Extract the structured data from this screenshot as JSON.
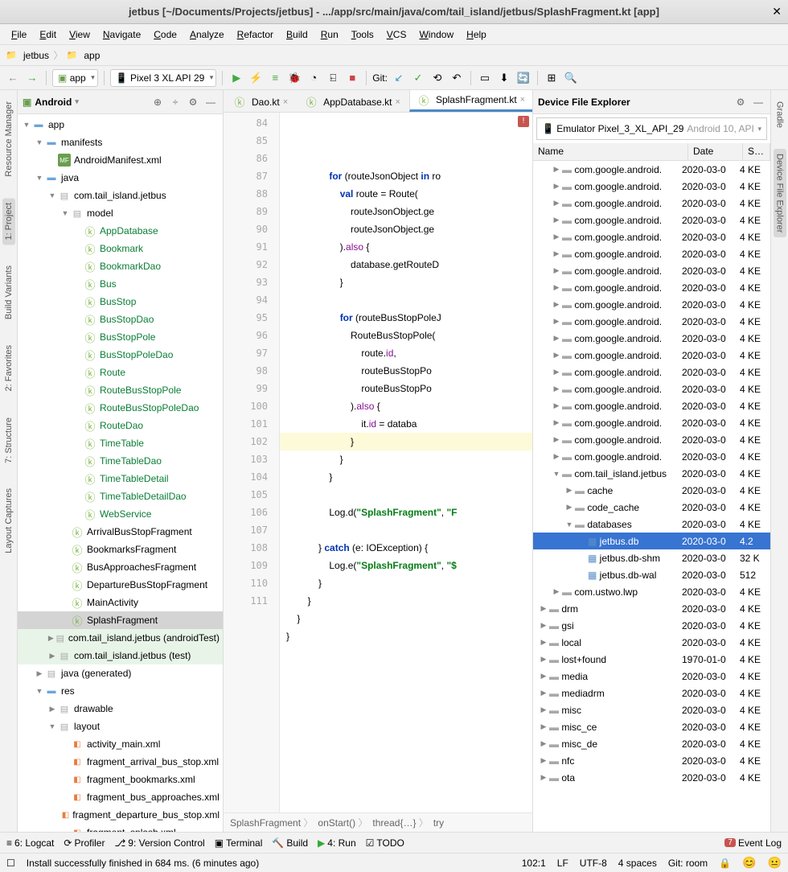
{
  "title": "jetbus [~/Documents/Projects/jetbus] - .../app/src/main/java/com/tail_island/jetbus/SplashFragment.kt [app]",
  "menu": [
    "File",
    "Edit",
    "View",
    "Navigate",
    "Code",
    "Analyze",
    "Refactor",
    "Build",
    "Run",
    "Tools",
    "VCS",
    "Window",
    "Help"
  ],
  "nav": {
    "p1": "jetbus",
    "p2": "app"
  },
  "toolbar": {
    "module": "app",
    "device": "Pixel 3 XL API 29",
    "git": "Git:"
  },
  "left_tabs": [
    "Resource Manager",
    "1: Project",
    "Build Variants",
    "2: Favorites",
    "7: Structure",
    "Layout Captures"
  ],
  "right_tabs": [
    "Gradle",
    "Device File Explorer"
  ],
  "project": {
    "view": "Android",
    "root": "app",
    "manifests": "manifests",
    "manifest_file": "AndroidManifest.xml",
    "java": "java",
    "pkg": "com.tail_island.jetbus",
    "model": "model",
    "model_items": [
      "AppDatabase",
      "Bookmark",
      "BookmarkDao",
      "Bus",
      "BusStop",
      "BusStopDao",
      "BusStopPole",
      "BusStopPoleDao",
      "Route",
      "RouteBusStopPole",
      "RouteBusStopPoleDao",
      "RouteDao",
      "TimeTable",
      "TimeTableDao",
      "TimeTableDetail",
      "TimeTableDetailDao",
      "WebService"
    ],
    "frags": [
      "ArrivalBusStopFragment",
      "BookmarksFragment",
      "BusApproachesFragment",
      "DepartureBusStopFragment",
      "MainActivity",
      "SplashFragment"
    ],
    "pkg2": "com.tail_island.jetbus",
    "pkg2s": "(androidTest)",
    "pkg3": "com.tail_island.jetbus",
    "pkg3s": "(test)",
    "gen": "java",
    "gens": "(generated)",
    "res": "res",
    "drawable": "drawable",
    "layout": "layout",
    "layouts": [
      "activity_main.xml",
      "fragment_arrival_bus_stop.xml",
      "fragment_bookmarks.xml",
      "fragment_bus_approaches.xml",
      "fragment_departure_bus_stop.xml",
      "fragment_splash.xml"
    ]
  },
  "tabs": [
    {
      "label": "Dao.kt",
      "active": false
    },
    {
      "label": "AppDatabase.kt",
      "active": false
    },
    {
      "label": "SplashFragment.kt",
      "active": true
    }
  ],
  "lines": [
    "84",
    "85",
    "86",
    "87",
    "88",
    "89",
    "90",
    "91",
    "92",
    "93",
    "94",
    "95",
    "96",
    "97",
    "98",
    "99",
    "100",
    "101",
    "102",
    "103",
    "104",
    "105",
    "106",
    "107",
    "108",
    "109",
    "110",
    "111"
  ],
  "crumbs": [
    "SplashFragment",
    "onStart()",
    "thread{…}",
    "try"
  ],
  "device": {
    "title": "Device File Explorer",
    "selector": "Emulator Pixel_3_XL_API_29",
    "selector_gray": "Android 10, API",
    "cols": {
      "name": "Name",
      "date": "Date",
      "size": "S…"
    },
    "rows": [
      {
        "indent": 1,
        "tw": "▶",
        "icon": "folder",
        "name": "com.google.android.",
        "date": "2020-03-0",
        "size": "4 KE"
      },
      {
        "indent": 1,
        "tw": "▶",
        "icon": "folder",
        "name": "com.google.android.",
        "date": "2020-03-0",
        "size": "4 KE"
      },
      {
        "indent": 1,
        "tw": "▶",
        "icon": "folder",
        "name": "com.google.android.",
        "date": "2020-03-0",
        "size": "4 KE"
      },
      {
        "indent": 1,
        "tw": "▶",
        "icon": "folder",
        "name": "com.google.android.",
        "date": "2020-03-0",
        "size": "4 KE"
      },
      {
        "indent": 1,
        "tw": "▶",
        "icon": "folder",
        "name": "com.google.android.",
        "date": "2020-03-0",
        "size": "4 KE"
      },
      {
        "indent": 1,
        "tw": "▶",
        "icon": "folder",
        "name": "com.google.android.",
        "date": "2020-03-0",
        "size": "4 KE"
      },
      {
        "indent": 1,
        "tw": "▶",
        "icon": "folder",
        "name": "com.google.android.",
        "date": "2020-03-0",
        "size": "4 KE"
      },
      {
        "indent": 1,
        "tw": "▶",
        "icon": "folder",
        "name": "com.google.android.",
        "date": "2020-03-0",
        "size": "4 KE"
      },
      {
        "indent": 1,
        "tw": "▶",
        "icon": "folder",
        "name": "com.google.android.",
        "date": "2020-03-0",
        "size": "4 KE"
      },
      {
        "indent": 1,
        "tw": "▶",
        "icon": "folder",
        "name": "com.google.android.",
        "date": "2020-03-0",
        "size": "4 KE"
      },
      {
        "indent": 1,
        "tw": "▶",
        "icon": "folder",
        "name": "com.google.android.",
        "date": "2020-03-0",
        "size": "4 KE"
      },
      {
        "indent": 1,
        "tw": "▶",
        "icon": "folder",
        "name": "com.google.android.",
        "date": "2020-03-0",
        "size": "4 KE"
      },
      {
        "indent": 1,
        "tw": "▶",
        "icon": "folder",
        "name": "com.google.android.",
        "date": "2020-03-0",
        "size": "4 KE"
      },
      {
        "indent": 1,
        "tw": "▶",
        "icon": "folder",
        "name": "com.google.android.",
        "date": "2020-03-0",
        "size": "4 KE"
      },
      {
        "indent": 1,
        "tw": "▶",
        "icon": "folder",
        "name": "com.google.android.",
        "date": "2020-03-0",
        "size": "4 KE"
      },
      {
        "indent": 1,
        "tw": "▶",
        "icon": "folder",
        "name": "com.google.android.",
        "date": "2020-03-0",
        "size": "4 KE"
      },
      {
        "indent": 1,
        "tw": "▶",
        "icon": "folder",
        "name": "com.google.android.",
        "date": "2020-03-0",
        "size": "4 KE"
      },
      {
        "indent": 1,
        "tw": "▶",
        "icon": "folder",
        "name": "com.google.android.",
        "date": "2020-03-0",
        "size": "4 KE"
      },
      {
        "indent": 1,
        "tw": "▼",
        "icon": "folder",
        "name": "com.tail_island.jetbus",
        "date": "2020-03-0",
        "size": "4 KE"
      },
      {
        "indent": 2,
        "tw": "▶",
        "icon": "folder",
        "name": "cache",
        "date": "2020-03-0",
        "size": "4 KE"
      },
      {
        "indent": 2,
        "tw": "▶",
        "icon": "folder",
        "name": "code_cache",
        "date": "2020-03-0",
        "size": "4 KE"
      },
      {
        "indent": 2,
        "tw": "▼",
        "icon": "folder",
        "name": "databases",
        "date": "2020-03-0",
        "size": "4 KE"
      },
      {
        "indent": 3,
        "tw": "",
        "icon": "db",
        "name": "jetbus.db",
        "date": "2020-03-0",
        "size": "4.2 ",
        "sel": true
      },
      {
        "indent": 3,
        "tw": "",
        "icon": "db",
        "name": "jetbus.db-shm",
        "date": "2020-03-0",
        "size": "32 K"
      },
      {
        "indent": 3,
        "tw": "",
        "icon": "db",
        "name": "jetbus.db-wal",
        "date": "2020-03-0",
        "size": "512"
      },
      {
        "indent": 1,
        "tw": "▶",
        "icon": "folder",
        "name": "com.ustwo.lwp",
        "date": "2020-03-0",
        "size": "4 KE"
      },
      {
        "indent": 0,
        "tw": "▶",
        "icon": "folder",
        "name": "drm",
        "date": "2020-03-0",
        "size": "4 KE"
      },
      {
        "indent": 0,
        "tw": "▶",
        "icon": "folder",
        "name": "gsi",
        "date": "2020-03-0",
        "size": "4 KE"
      },
      {
        "indent": 0,
        "tw": "▶",
        "icon": "folder",
        "name": "local",
        "date": "2020-03-0",
        "size": "4 KE"
      },
      {
        "indent": 0,
        "tw": "▶",
        "icon": "folder",
        "name": "lost+found",
        "date": "1970-01-0",
        "size": "4 KE"
      },
      {
        "indent": 0,
        "tw": "▶",
        "icon": "folder",
        "name": "media",
        "date": "2020-03-0",
        "size": "4 KE"
      },
      {
        "indent": 0,
        "tw": "▶",
        "icon": "folder",
        "name": "mediadrm",
        "date": "2020-03-0",
        "size": "4 KE"
      },
      {
        "indent": 0,
        "tw": "▶",
        "icon": "folder",
        "name": "misc",
        "date": "2020-03-0",
        "size": "4 KE"
      },
      {
        "indent": 0,
        "tw": "▶",
        "icon": "folder",
        "name": "misc_ce",
        "date": "2020-03-0",
        "size": "4 KE"
      },
      {
        "indent": 0,
        "tw": "▶",
        "icon": "folder",
        "name": "misc_de",
        "date": "2020-03-0",
        "size": "4 KE"
      },
      {
        "indent": 0,
        "tw": "▶",
        "icon": "folder",
        "name": "nfc",
        "date": "2020-03-0",
        "size": "4 KE"
      },
      {
        "indent": 0,
        "tw": "▶",
        "icon": "folder",
        "name": "ota",
        "date": "2020-03-0",
        "size": "4 KE"
      }
    ]
  },
  "bottom": {
    "logcat": "6: Logcat",
    "profiler": "Profiler",
    "vcs": "9: Version Control",
    "terminal": "Terminal",
    "build": "Build",
    "run": "4: Run",
    "todo": "TODO",
    "event": "Event Log",
    "event_n": "7"
  },
  "status": {
    "msg": "Install successfully finished in 684 ms. (6 minutes ago)",
    "pos": "102:1",
    "lf": "LF",
    "enc": "UTF-8",
    "indent": "4 spaces",
    "git": "Git: room"
  }
}
